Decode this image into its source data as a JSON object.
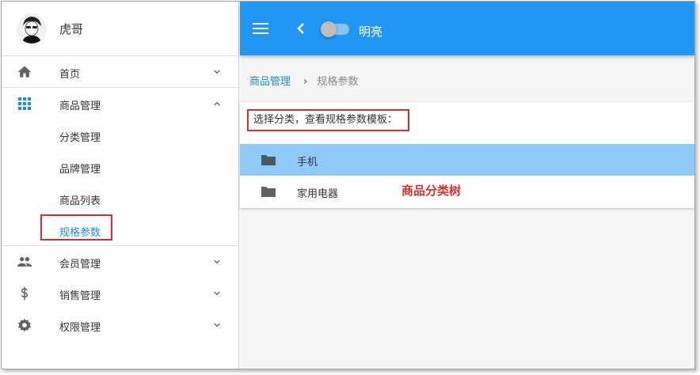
{
  "user": {
    "name": "虎哥"
  },
  "sidebar": {
    "items": [
      {
        "icon": "home-icon",
        "label": "首页",
        "expanded": false
      },
      {
        "icon": "apps-grid-icon",
        "label": "商品管理",
        "expanded": true,
        "children": [
          "分类管理",
          "品牌管理",
          "商品列表",
          "规格参数"
        ],
        "active_child": "规格参数"
      },
      {
        "icon": "people-icon",
        "label": "会员管理",
        "expanded": false
      },
      {
        "icon": "dollar-icon",
        "label": "销售管理",
        "expanded": false
      },
      {
        "icon": "gear-icon",
        "label": "权限管理",
        "expanded": false
      }
    ]
  },
  "topbar": {
    "menu_icon": "menu-icon",
    "back_icon": "chevron-left-icon",
    "theme_toggle_on": false,
    "theme_label": "明亮",
    "color": "#2196f3"
  },
  "breadcrumb": {
    "parent": "商品管理",
    "current": "规格参数"
  },
  "content": {
    "prompt": "选择分类，查看规格参数模板：",
    "tree": [
      {
        "label": "手机",
        "selected": true
      },
      {
        "label": "家用电器",
        "selected": false
      }
    ],
    "annotation": "商品分类树"
  },
  "colors": {
    "accent": "#1e88e5",
    "highlight_border": "#d32f2f",
    "selected_row": "#90caf9"
  }
}
